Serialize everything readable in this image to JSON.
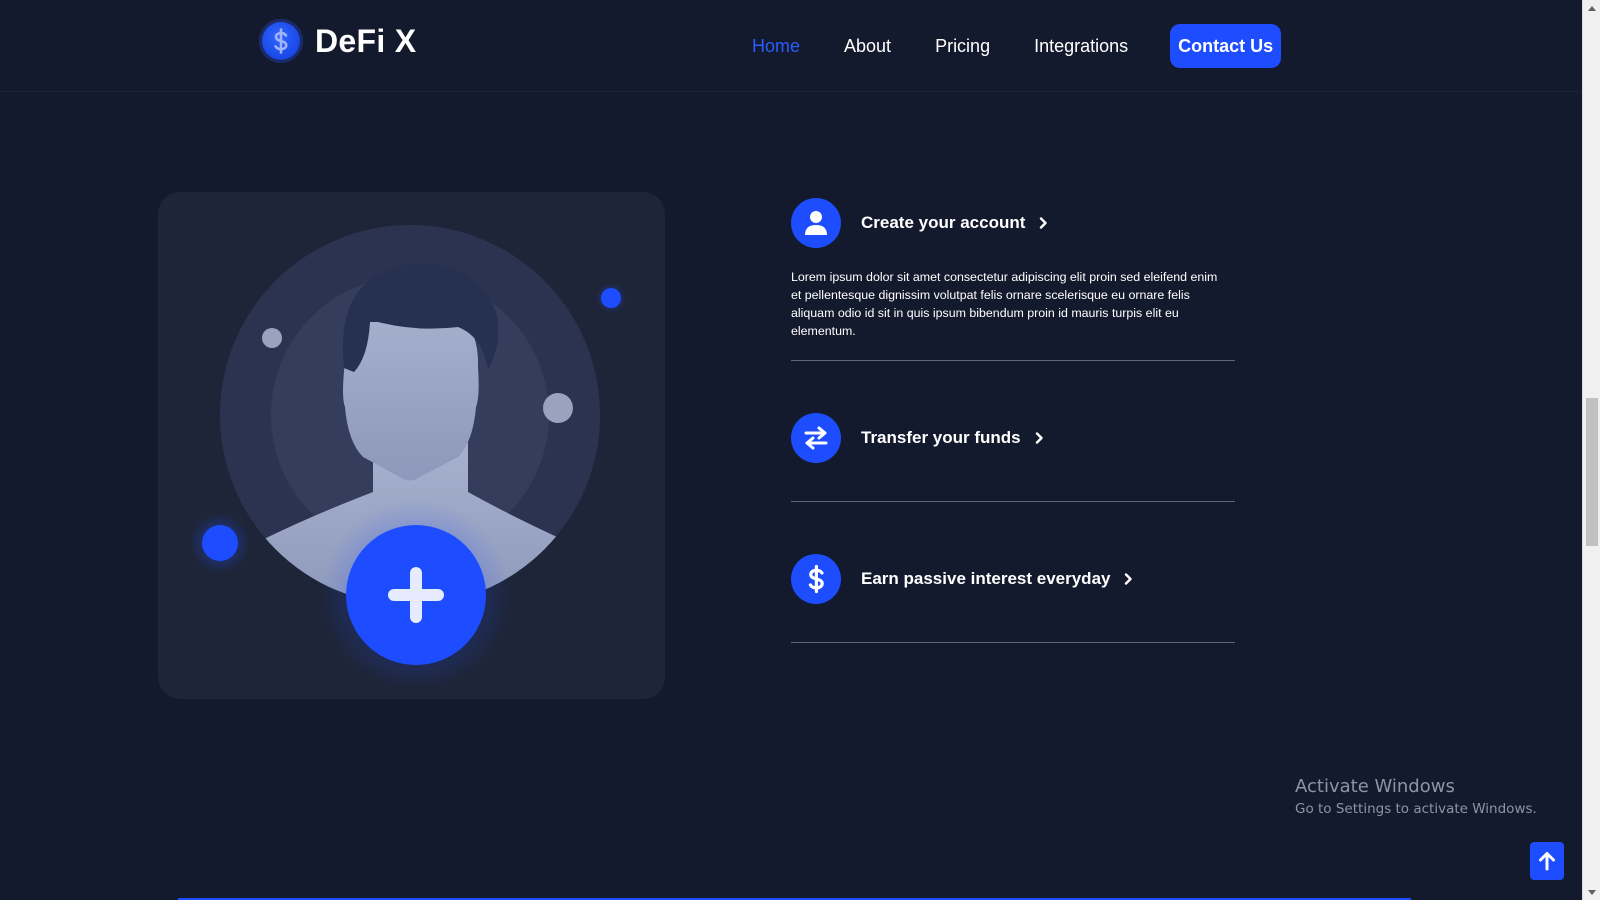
{
  "brand": {
    "name": "DeFi X",
    "logo_icon": "dollar-icon"
  },
  "nav": {
    "items": [
      {
        "label": "Home",
        "active": true
      },
      {
        "label": "About",
        "active": false
      },
      {
        "label": "Pricing",
        "active": false
      },
      {
        "label": "Integrations",
        "active": false
      }
    ],
    "cta_label": "Contact Us"
  },
  "illustration": {
    "icon": "add-user-icon"
  },
  "steps": [
    {
      "icon": "user-icon",
      "title": "Create your account",
      "description": "Lorem ipsum dolor sit amet consectetur adipiscing elit proin sed eleifend enim et pellentesque dignissim volutpat felis ornare scelerisque eu ornare felis aliquam odio id sit in quis ipsum bibendum proin id mauris turpis elit eu elementum."
    },
    {
      "icon": "transfer-arrows-icon",
      "title": "Transfer your funds",
      "description": ""
    },
    {
      "icon": "dollar-icon",
      "title": "Earn passive interest everyday",
      "description": ""
    }
  ],
  "watermark": {
    "title": "Activate Windows",
    "subtitle": "Go to Settings to activate Windows."
  },
  "back_to_top": {
    "icon": "arrow-up-icon"
  },
  "colors": {
    "background": "#141a2d",
    "card": "#1e2539",
    "accent": "#1d4dff",
    "divider": "#5e6577"
  }
}
